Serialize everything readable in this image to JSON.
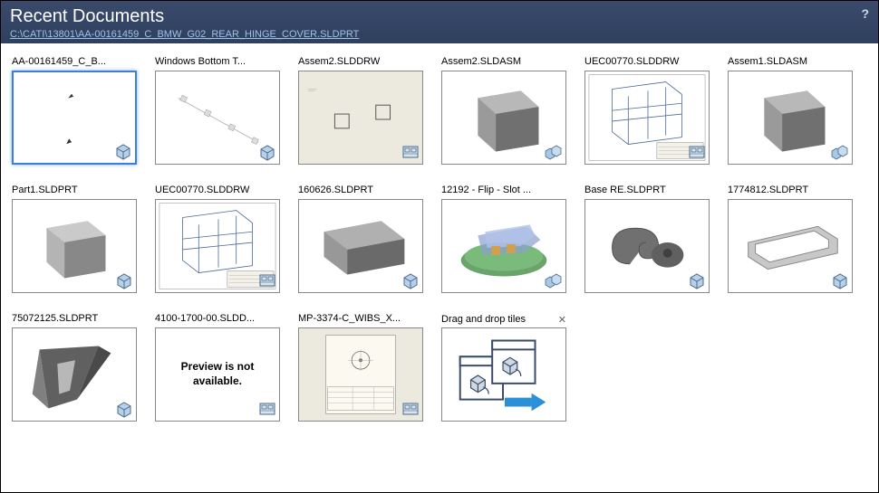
{
  "header": {
    "title": "Recent Documents",
    "path": "C:\\CATI\\13801\\AA-00161459_C_BMW_G02_REAR_HINGE_COVER.SLDPRT",
    "help": "?"
  },
  "tiles": [
    {
      "label": "AA-00161459_C_B...",
      "kind": "part",
      "selected": true,
      "preview": "sparse"
    },
    {
      "label": "Windows Bottom T...",
      "kind": "part",
      "preview": "sketch"
    },
    {
      "label": "Assem2.SLDDRW",
      "kind": "drawing",
      "preview": "drawing-boxes"
    },
    {
      "label": "Assem2.SLDASM",
      "kind": "asm",
      "preview": "cube"
    },
    {
      "label": "UEC00770.SLDDRW",
      "kind": "drawing",
      "preview": "rack-dwg"
    },
    {
      "label": "Assem1.SLDASM",
      "kind": "asm",
      "preview": "cube"
    },
    {
      "label": "Part1.SLDPRT",
      "kind": "part",
      "preview": "cube-light"
    },
    {
      "label": "UEC00770.SLDDRW",
      "kind": "drawing",
      "preview": "rack-dwg"
    },
    {
      "label": "160626.SLDPRT",
      "kind": "part",
      "preview": "slab"
    },
    {
      "label": "12192 - Flip - Slot ...",
      "kind": "asm",
      "preview": "flip"
    },
    {
      "label": "Base RE.SLDPRT",
      "kind": "part",
      "preview": "snail"
    },
    {
      "label": "1774812.SLDPRT",
      "kind": "part",
      "preview": "frame"
    },
    {
      "label": "75072125.SLDPRT",
      "kind": "part",
      "preview": "wedge"
    },
    {
      "label": "4100-1700-00.SLDD...",
      "kind": "drawing",
      "preview": "unavailable"
    },
    {
      "label": "MP-3374-C_WIBS_X...",
      "kind": "drawing",
      "preview": "drawing-sheet"
    }
  ],
  "dragTile": {
    "label": "Drag and drop tiles",
    "close": "✕"
  },
  "unavailable_text": "Preview is not available."
}
